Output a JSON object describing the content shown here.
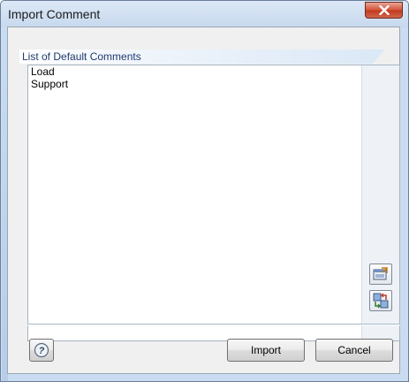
{
  "window": {
    "title": "Import Comment",
    "close_icon": "close-icon"
  },
  "group": {
    "label": "List of Default Comments"
  },
  "list": {
    "items": [
      "Load",
      "Support"
    ]
  },
  "side_buttons": {
    "import_file_icon": "import-from-file-icon",
    "export_file_icon": "export-to-file-icon"
  },
  "buttons": {
    "help_icon": "help-icon",
    "import_label": "Import",
    "cancel_label": "Cancel"
  },
  "colors": {
    "frame": "#c9dcf1",
    "close_red": "#c13b1f",
    "group_label": "#1e3a6e"
  }
}
